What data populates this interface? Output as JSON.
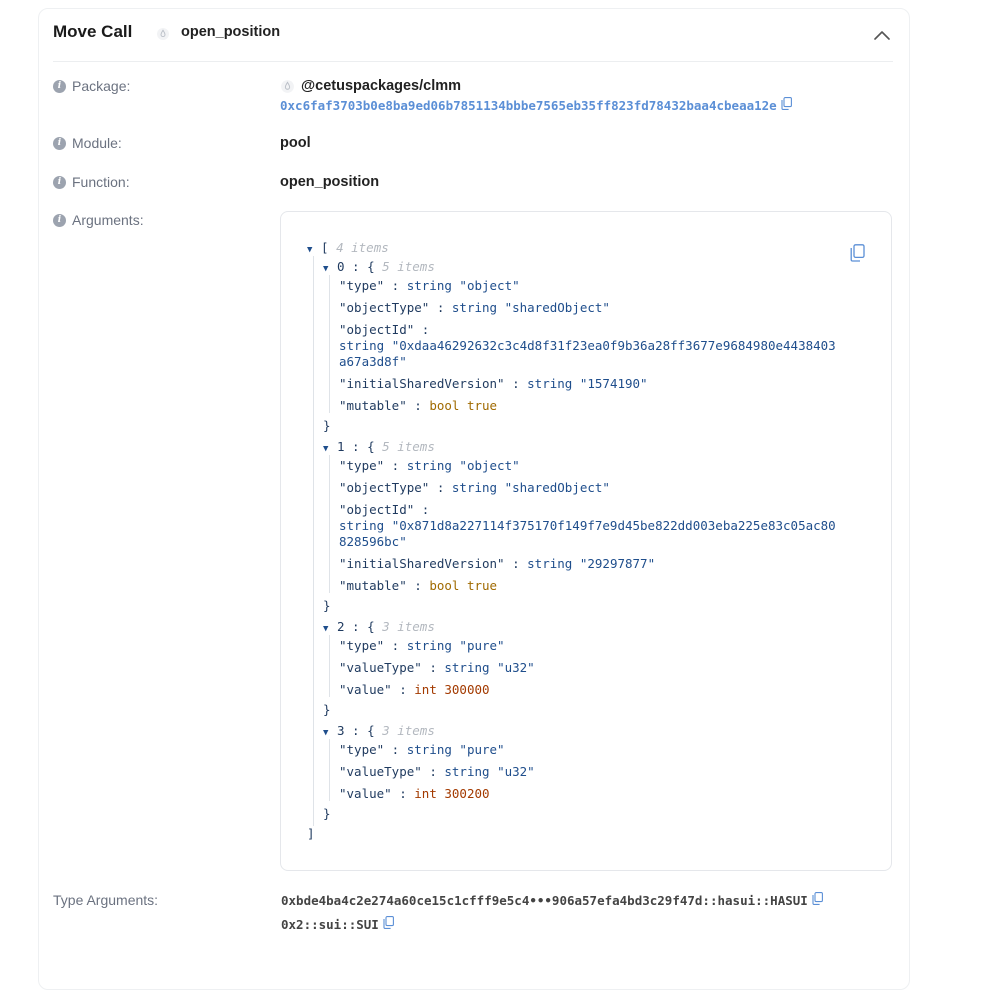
{
  "header": {
    "title": "Move Call",
    "function_name": "open_position"
  },
  "package": {
    "label": "Package:",
    "name": "@cetuspackages/clmm",
    "address": "0xc6faf3703b0e8ba9ed06b7851134bbbe7565eb35ff823fd78432baa4cbeaa12e"
  },
  "module": {
    "label": "Module:",
    "value": "pool"
  },
  "function": {
    "label": "Function:",
    "value": "open_position"
  },
  "arguments": {
    "label": "Arguments:",
    "root_count": "4 items",
    "items": [
      {
        "index": "0",
        "count": "5 items",
        "type": "\"object\"",
        "objectType": "\"sharedObject\"",
        "objectId_line1": "\"0xdaa46292632c3c4d8f31f23ea0f9b36a28ff3677e9684980e4438403",
        "objectId_line2": "a67a3d8f\"",
        "initialSharedVersion": "\"1574190\"",
        "mutable": "true"
      },
      {
        "index": "1",
        "count": "5 items",
        "type": "\"object\"",
        "objectType": "\"sharedObject\"",
        "objectId_line1": "\"0x871d8a227114f375170f149f7e9d45be822dd003eba225e83c05ac80",
        "objectId_line2": "828596bc\"",
        "initialSharedVersion": "\"29297877\"",
        "mutable": "true"
      },
      {
        "index": "2",
        "count": "3 items",
        "type": "\"pure\"",
        "valueType": "\"u32\"",
        "value": "300000"
      },
      {
        "index": "3",
        "count": "3 items",
        "type": "\"pure\"",
        "valueType": "\"u32\"",
        "value": "300200"
      }
    ],
    "keys": {
      "type": "\"type\"",
      "objectType": "\"objectType\"",
      "objectId": "\"objectId\"",
      "initialSharedVersion": "\"initialSharedVersion\"",
      "mutable": "\"mutable\"",
      "valueType": "\"valueType\"",
      "value": "\"value\""
    },
    "types": {
      "string": "string",
      "bool": "bool",
      "int": "int"
    }
  },
  "type_arguments": {
    "label": "Type Arguments:",
    "values": [
      "0xbde4ba4c2e274a60ce15c1cfff9e5c4•••906a57efa4bd3c29f47d::hasui::HASUI",
      "0x2::sui::SUI"
    ]
  }
}
